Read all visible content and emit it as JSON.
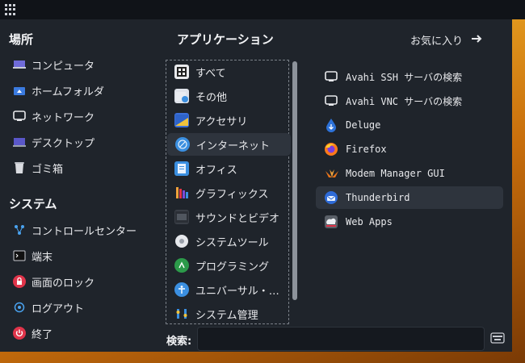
{
  "places": {
    "title": "場所",
    "items": [
      {
        "label": "コンピュータ",
        "icon": "computer-icon"
      },
      {
        "label": "ホームフォルダ",
        "icon": "home-folder-icon"
      },
      {
        "label": "ネットワーク",
        "icon": "network-icon"
      },
      {
        "label": "デスクトップ",
        "icon": "desktop-icon"
      },
      {
        "label": "ゴミ箱",
        "icon": "trash-icon"
      }
    ]
  },
  "system": {
    "title": "システム",
    "items": [
      {
        "label": "コントロールセンター",
        "icon": "control-center-icon"
      },
      {
        "label": "端末",
        "icon": "terminal-icon"
      },
      {
        "label": "画面のロック",
        "icon": "lock-icon"
      },
      {
        "label": "ログアウト",
        "icon": "logout-icon"
      },
      {
        "label": "終了",
        "icon": "power-icon"
      }
    ]
  },
  "applications": {
    "title": "アプリケーション",
    "categories": [
      {
        "label": "すべて",
        "icon": "all-apps-icon"
      },
      {
        "label": "その他",
        "icon": "other-icon"
      },
      {
        "label": "アクセサリ",
        "icon": "accessories-icon"
      },
      {
        "label": "インターネット",
        "icon": "internet-icon",
        "active": true
      },
      {
        "label": "オフィス",
        "icon": "office-icon"
      },
      {
        "label": "グラフィックス",
        "icon": "graphics-icon"
      },
      {
        "label": "サウンドとビデオ",
        "icon": "sound-video-icon"
      },
      {
        "label": "システムツール",
        "icon": "system-tools-icon"
      },
      {
        "label": "プログラミング",
        "icon": "programming-icon"
      },
      {
        "label": "ユニバーサル・…",
        "icon": "universal-access-icon"
      },
      {
        "label": "システム管理",
        "icon": "administration-icon"
      }
    ]
  },
  "favorites_link": "お気に入り",
  "apps": [
    {
      "label": "Avahi SSH サーバの検索",
      "icon": "avahi-ssh-icon"
    },
    {
      "label": "Avahi VNC サーバの検索",
      "icon": "avahi-vnc-icon"
    },
    {
      "label": "Deluge",
      "icon": "deluge-icon"
    },
    {
      "label": "Firefox",
      "icon": "firefox-icon"
    },
    {
      "label": "Modem Manager GUI",
      "icon": "modem-manager-icon"
    },
    {
      "label": "Thunderbird",
      "icon": "thunderbird-icon",
      "active": true
    },
    {
      "label": "Web Apps",
      "icon": "web-apps-icon"
    }
  ],
  "search": {
    "label": "検索:",
    "value": "",
    "placeholder": ""
  },
  "colors": {
    "panel": "#1f242b",
    "highlight": "#2e343d",
    "topbar": "#101318",
    "wallpaper": "#e39a1f"
  }
}
